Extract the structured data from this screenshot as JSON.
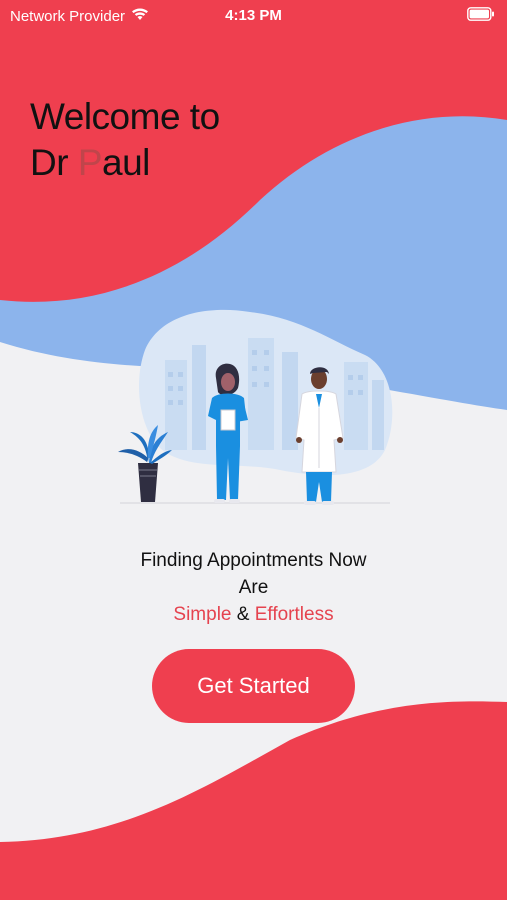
{
  "status_bar": {
    "carrier": "Network Provider",
    "time": "4:13 PM",
    "wifi_icon": "wifi-icon",
    "battery_icon": "battery-icon"
  },
  "hero": {
    "welcome_line1": "Welcome to",
    "name_prefix": "Dr ",
    "name_accent": "P",
    "name_suffix": "aul"
  },
  "illustration": {
    "plant_icon": "potted-plant-icon",
    "nurse_icon": "nurse-figure-icon",
    "doctor_icon": "doctor-figure-icon"
  },
  "tagline": {
    "line1": "Finding Appointments Now",
    "line2": "Are",
    "word_simple": "Simple",
    "ampersand": " & ",
    "word_effortless": "Effortless"
  },
  "cta": {
    "label": "Get Started"
  },
  "colors": {
    "primary_red": "#ef3f4f",
    "wave_blue": "#8cb4ec",
    "background": "#f1f1f3",
    "text_dark": "#111111"
  }
}
